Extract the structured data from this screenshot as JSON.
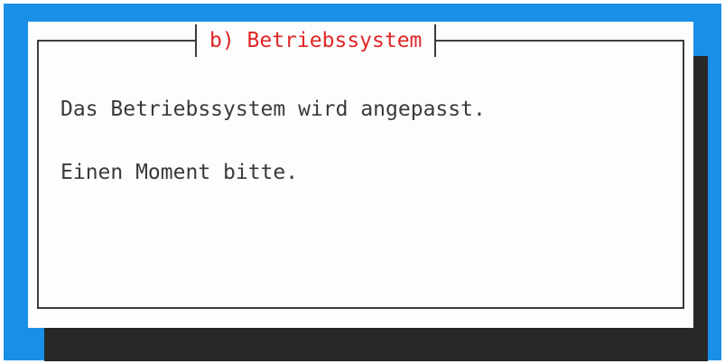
{
  "dialog": {
    "title": "b) Betriebssystem",
    "message_line1": "Das Betriebssystem wird angepasst.",
    "message_line2": "Einen Moment bitte."
  },
  "colors": {
    "background": "#1a8fe8",
    "dialog_bg": "#fdfdfd",
    "shadow": "#282828",
    "title_text": "#e02626",
    "body_text": "#3a3a3a",
    "border": "#3c3c3c"
  }
}
